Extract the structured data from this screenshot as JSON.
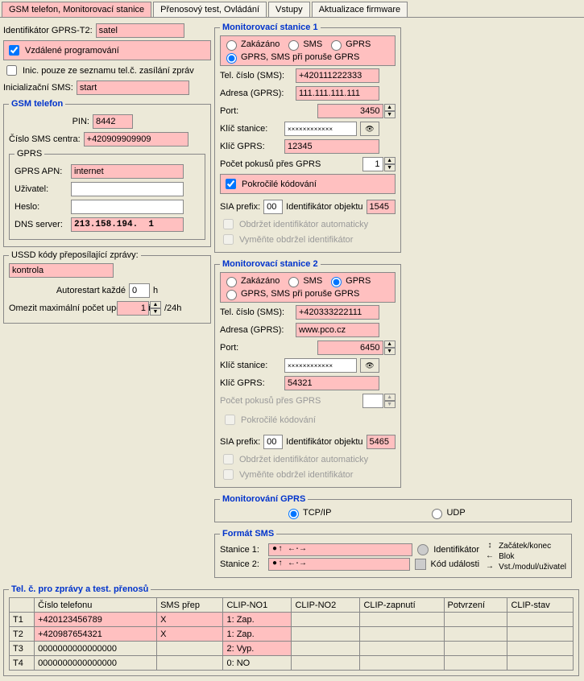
{
  "tabs": [
    "GSM telefon, Monitorovací stanice",
    "Přenosový test, Ovládání",
    "Vstupy",
    "Aktualizace firmware"
  ],
  "left": {
    "gprs_t2_label": "Identifikátor GPRS-T2:",
    "gprs_t2": "satel",
    "remote_prog": "Vzdálené programování",
    "init_only": "Inic. pouze ze seznamu tel.č. zasílání zpráv",
    "init_sms_label": "Inicializační SMS:",
    "init_sms": "start",
    "gsm_legend": "GSM telefon",
    "pin_label": "PIN:",
    "pin": "8442",
    "sms_center_label": "Číslo SMS centra:",
    "sms_center": "+420909909909",
    "gprs_legend": "GPRS",
    "apn_label": "GPRS APN:",
    "apn": "internet",
    "user_label": "Uživatel:",
    "user": "",
    "pass_label": "Heslo:",
    "pass": "",
    "dns_label": "DNS server:",
    "dns": "213.158.194.  1",
    "ussd_legend": "USSD kódy přeposílající zprávy:",
    "ussd": "kontrola",
    "autorestart_label": "Autorestart každé",
    "autorestart": "0",
    "autorestart_unit": "h",
    "limit_label": "Omezit maximální počet upozornění",
    "limit": "1",
    "limit_unit": "/24h"
  },
  "mon1": {
    "legend": "Monitorovací stanice 1",
    "r": {
      "disabled": "Zakázáno",
      "sms": "SMS",
      "gprs": "GPRS",
      "gprs_sms": "GPRS, SMS při poruše GPRS"
    },
    "tel_label": "Tel. číslo (SMS):",
    "tel": "+420111222333",
    "addr_label": "Adresa (GPRS):",
    "addr": "111.111.111.111",
    "port_label": "Port:",
    "port": "3450",
    "key_label": "Klíč stanice:",
    "key": "××××××××××××",
    "gprs_key_label": "Klíč GPRS:",
    "gprs_key": "12345",
    "retries_label": "Počet pokusů přes GPRS",
    "retries": "1",
    "adv_encoding": "Pokročilé kódování",
    "sia_label": "SIA prefix:",
    "sia": "00",
    "obj_label": "Identifikátor objektu",
    "obj": "1545",
    "auto_id": "Obdržet identifikátor automaticky",
    "replace_id": "Vyměňte obdržel identifikátor"
  },
  "mon2": {
    "legend": "Monitorovací stanice 2",
    "tel": "+420333222111",
    "addr": "www.pco.cz",
    "port": "6450",
    "key": "××××××××××××",
    "gprs_key": "54321",
    "obj": "5465"
  },
  "mon_gprs": {
    "legend": "Monitorování GPRS",
    "tcp": "TCP/IP",
    "udp": "UDP"
  },
  "sms_format": {
    "legend": "Formát SMS",
    "s1_label": "Stanice 1:",
    "s1": "●↑  ←·→",
    "s2_label": "Stanice 2:",
    "s2": "●↑  ←·→",
    "ident": "Identifikátor",
    "evcode": "Kód události",
    "leg1": "Začátek/konec",
    "leg2": "Blok",
    "leg3": "Vst./modul/uživatel"
  },
  "tel_table": {
    "legend": "Tel. č. pro zprávy a test. přenosů",
    "cols": [
      "",
      "Číslo telefonu",
      "SMS přep",
      "CLIP-NO1",
      "CLIP-NO2",
      "CLIP-zapnutí",
      "Potvrzení",
      "CLIP-stav"
    ],
    "rows": [
      {
        "t": "T1",
        "num": "+420123456789",
        "sms": "X",
        "c1": "1: Zap.",
        "c2": "",
        "on": "",
        "conf": "",
        "stat": "",
        "pink": true
      },
      {
        "t": "T2",
        "num": "+420987654321",
        "sms": "X",
        "c1": "1: Zap.",
        "c2": "",
        "on": "",
        "conf": "",
        "stat": "",
        "pink": true
      },
      {
        "t": "T3",
        "num": "0000000000000000",
        "sms": "",
        "c1": "2: Vyp.",
        "c2": "",
        "on": "",
        "conf": "",
        "stat": "",
        "c1pink": true
      },
      {
        "t": "T4",
        "num": "0000000000000000",
        "sms": "",
        "c1": "0: NO",
        "c2": "",
        "on": "",
        "conf": "",
        "stat": ""
      }
    ]
  }
}
